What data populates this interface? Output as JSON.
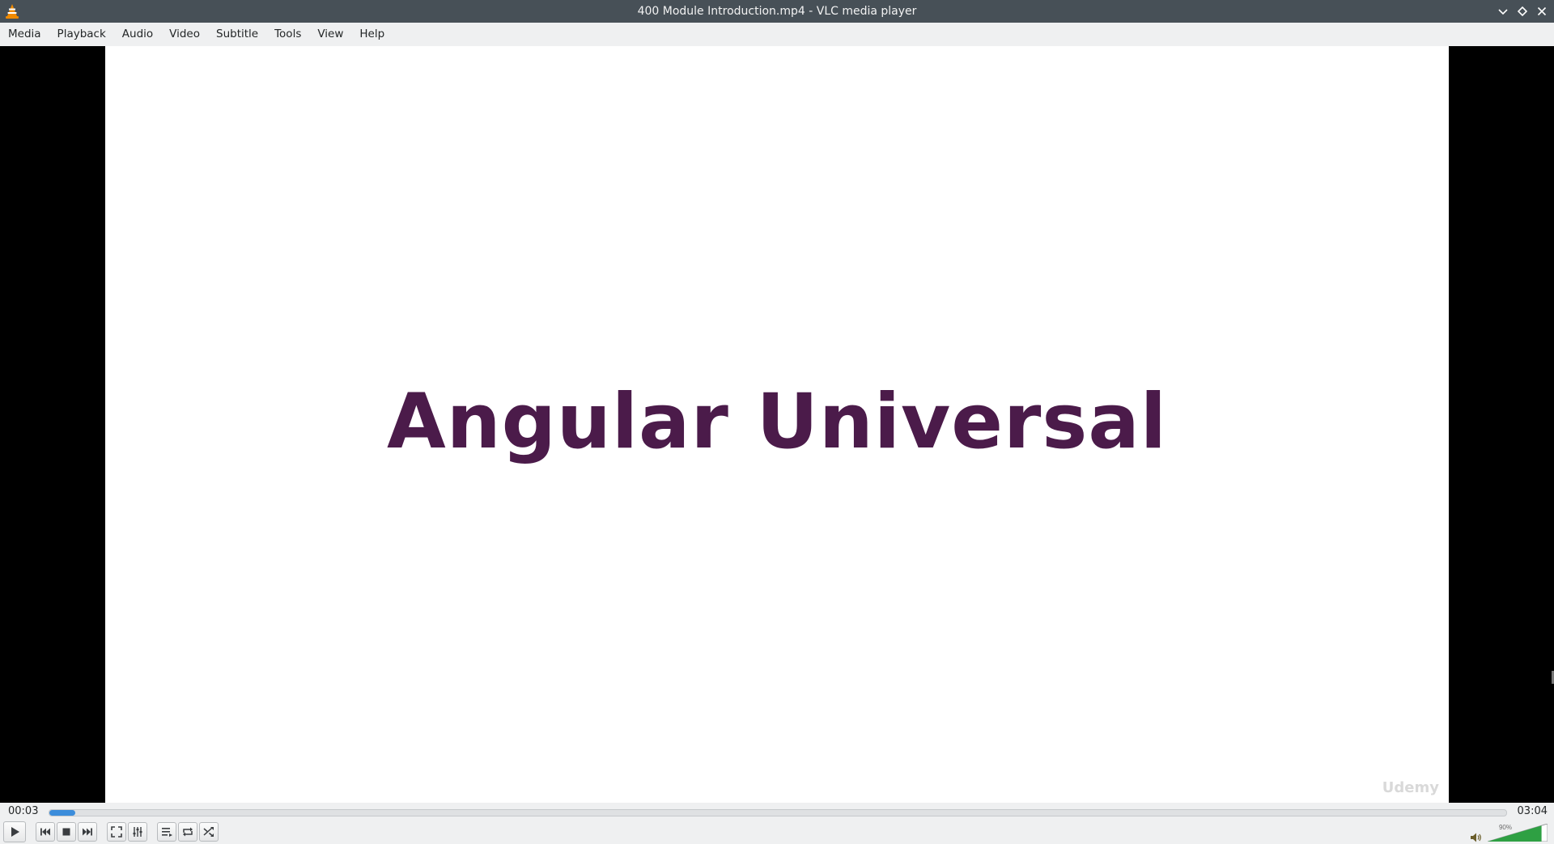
{
  "window": {
    "title": "400 Module Introduction.mp4 - VLC media player"
  },
  "menu": {
    "items": [
      "Media",
      "Playback",
      "Audio",
      "Video",
      "Subtitle",
      "Tools",
      "View",
      "Help"
    ]
  },
  "video": {
    "slide_title": "Angular Universal",
    "watermark": "Udemy"
  },
  "playback": {
    "elapsed": "00:03",
    "total": "03:04",
    "progress_fraction": 0.018
  },
  "volume": {
    "label": "90%",
    "level": 0.9
  },
  "colors": {
    "slide_text": "#4b1b4a",
    "seek_fill": "#3c8ddb",
    "volume_fill": "#2ea043",
    "titlebar": "#475057"
  },
  "icons": {
    "app": "vlc-cone-icon",
    "minimize": "chevron-down-icon",
    "maximize": "diamond-icon",
    "close": "close-icon",
    "play": "play-icon",
    "prev": "previous-icon",
    "stop": "stop-icon",
    "next": "next-icon",
    "fullscreen": "fullscreen-icon",
    "extended": "equalizer-icon",
    "playlist": "playlist-icon",
    "loop": "loop-icon",
    "shuffle": "shuffle-icon",
    "volume": "speaker-icon"
  }
}
